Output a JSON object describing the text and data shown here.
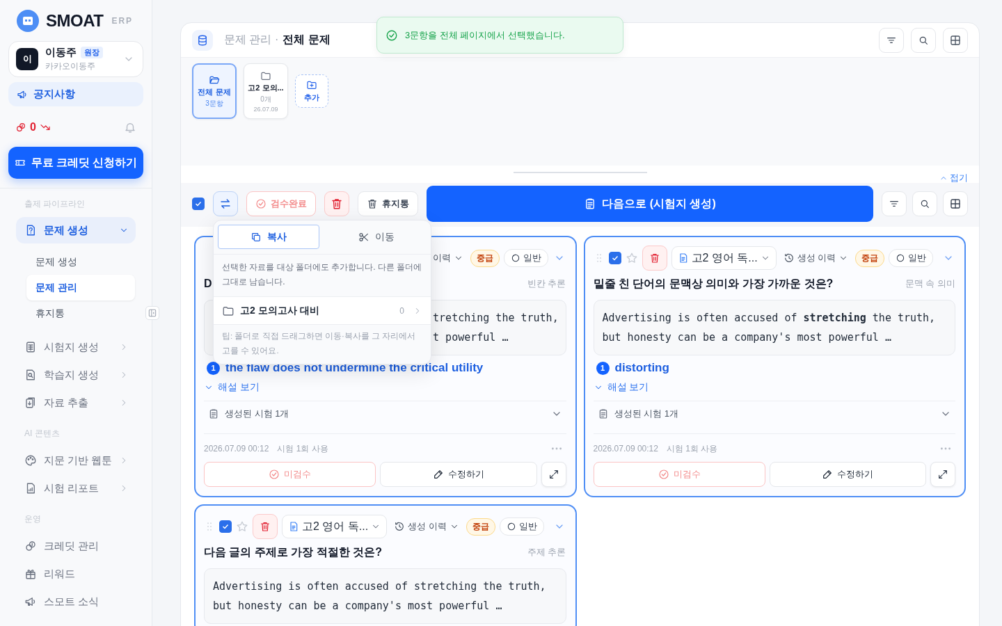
{
  "sidebar": {
    "logo": {
      "name": "SMOAT",
      "suffix": "ERP"
    },
    "user": {
      "initial": "이",
      "name": "이동주",
      "role": "원장",
      "org": "카카오이동주"
    },
    "notice": "공지사항",
    "credits": {
      "count": "0"
    },
    "cta": "무료 크레딧 신청하기",
    "sections": [
      {
        "title": "출제 파이프라인",
        "items": [
          {
            "label": "문제 생성",
            "kind": "group",
            "expanded": true,
            "children": [
              {
                "label": "문제 생성",
                "selected": false
              },
              {
                "label": "문제 관리",
                "selected": true
              },
              {
                "label": "휴지통",
                "selected": false
              }
            ]
          },
          {
            "label": "시험지 생성",
            "kind": "group",
            "expanded": false
          },
          {
            "label": "학습지 생성",
            "kind": "group",
            "expanded": false
          },
          {
            "label": "자료 추출",
            "kind": "group",
            "expanded": false
          }
        ]
      },
      {
        "title": "AI 콘텐츠",
        "items": [
          {
            "label": "지문 기반 웹툰",
            "kind": "group",
            "expanded": false
          },
          {
            "label": "시험 리포트",
            "kind": "group",
            "expanded": false
          }
        ]
      },
      {
        "title": "운영",
        "items": [
          {
            "label": "크레딧 관리",
            "kind": "link"
          },
          {
            "label": "리워드",
            "kind": "link"
          },
          {
            "label": "스모트 소식",
            "kind": "link"
          }
        ]
      }
    ]
  },
  "toast": {
    "message": "3문항을 전체 페이지에서 선택했습니다."
  },
  "header": {
    "breadcrumb": "문제 관리 ·",
    "title": "전체 문제"
  },
  "folders": [
    {
      "name": "전체 문제",
      "count": "3문항",
      "selected": true
    },
    {
      "name": "고2 모의...",
      "count": "0개",
      "date": "26.07.09",
      "selected": false
    }
  ],
  "add_folder": "추가",
  "collapse": "접기",
  "toolbar": {
    "select_all": {
      "checked": true
    },
    "review_done": "검수완료",
    "trash": "휴지통",
    "next": "다음으로 (시험지 생성)"
  },
  "popover": {
    "tabs": [
      {
        "label": "복사",
        "selected": true
      },
      {
        "label": "이동",
        "selected": false
      }
    ],
    "description": "선택한 자료를 대상 폴더에도 추가합니다. 다른 폴더에 그대로 남습니다.",
    "folders": [
      {
        "name": "고2 모의고사 대비",
        "count": "0"
      }
    ],
    "tip": "팁: 폴더로 직접 드래그하면 이동·복사를 그 자리에서 고를 수 있어요."
  },
  "cards": [
    {
      "kind": "covered",
      "history": "이력",
      "level": "중급",
      "type": "일반",
      "question": "D",
      "category": "빈칸 추론",
      "passage": [
        "tretching the truth,",
        "t powerful …"
      ],
      "answer_no": "1",
      "answer": "the flaw does not undermine the critical utility",
      "explain": "해설 보기",
      "exams": "생성된 시험 1개",
      "date": "2026.07.09 00:12",
      "usage": "시험 1회 사용",
      "review": "미검수",
      "edit": "수정하기"
    },
    {
      "kind": "full",
      "selected": true,
      "starred": false,
      "source": "고2 영어 독...",
      "history": "생성 이력",
      "level": "중급",
      "type": "일반",
      "question": "밑줄 친 단어의 문맥상 의미와 가장 가까운 것은?",
      "category": "문맥 속 의미",
      "passage": [
        "Advertising is often accused of **stretching** the truth,",
        "but honesty can be a company's most powerful …"
      ],
      "answer_no": "1",
      "answer": "distorting",
      "explain": "해설 보기",
      "exams": "생성된 시험 1개",
      "date": "2026.07.09 00:12",
      "usage": "시험 1회 사용",
      "review": "미검수",
      "edit": "수정하기"
    },
    {
      "kind": "full",
      "selected": true,
      "starred": false,
      "source": "고2 영어 독...",
      "history": "생성 이력",
      "level": "중급",
      "type": "일반",
      "question": "다음 글의 주제로 가장 적절한 것은?",
      "category": "주제 추론",
      "passage": [
        "Advertising is often accused of stretching the truth,",
        "but honesty can be a company's most powerful …"
      ]
    }
  ]
}
